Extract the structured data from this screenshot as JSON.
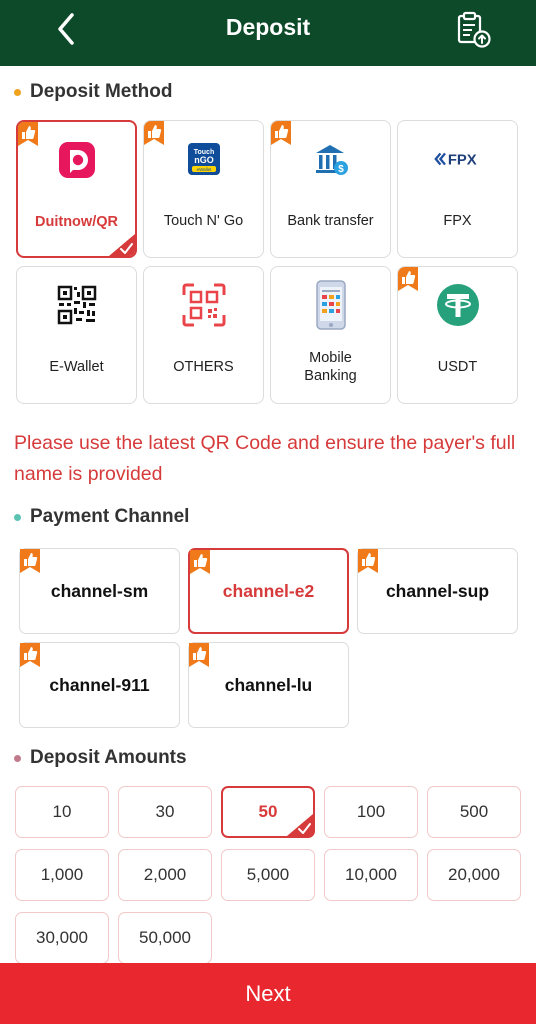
{
  "header": {
    "title": "Deposit"
  },
  "sections": {
    "method": "Deposit Method",
    "channel": "Payment Channel",
    "amounts": "Deposit Amounts"
  },
  "colors": {
    "header_bg": "#0d4a2a",
    "accent_red": "#d63a3a",
    "next_bg": "#e8282e",
    "dot_method": "#f0a21c",
    "dot_channel": "#5cc3b3",
    "dot_amounts": "#c07a8c"
  },
  "methods": [
    {
      "label": "Duitnow/QR",
      "icon": "duitnow-icon",
      "selected": true,
      "badge": true
    },
    {
      "label": "Touch N' Go",
      "icon": "touch-n-go-icon",
      "selected": false,
      "badge": true
    },
    {
      "label": "Bank transfer",
      "icon": "bank-icon",
      "selected": false,
      "badge": true
    },
    {
      "label": "FPX",
      "icon": "fpx-icon",
      "selected": false,
      "badge": false
    },
    {
      "label": "E-Wallet",
      "icon": "qr-code-icon",
      "selected": false,
      "badge": false
    },
    {
      "label": "OTHERS",
      "icon": "qr-scan-icon",
      "selected": false,
      "badge": false
    },
    {
      "label": "Mobile Banking",
      "icon": "mobile-banking-icon",
      "selected": false,
      "badge": false
    },
    {
      "label": "USDT",
      "icon": "tether-icon",
      "selected": false,
      "badge": true
    }
  ],
  "icon_text": {
    "tng_line1": "Touch",
    "tng_line2": "nGO",
    "tng_line3": "eWallet",
    "fpx": "FPX"
  },
  "notice": "Please use the latest QR Code and ensure the payer's full name is provided",
  "channels": [
    {
      "label": "channel-sm",
      "selected": false
    },
    {
      "label": "channel-e2",
      "selected": true
    },
    {
      "label": "channel-sup",
      "selected": false
    },
    {
      "label": "channel-911",
      "selected": false
    },
    {
      "label": "channel-lu",
      "selected": false
    }
  ],
  "amounts": [
    {
      "label": "10",
      "selected": false
    },
    {
      "label": "30",
      "selected": false
    },
    {
      "label": "50",
      "selected": true
    },
    {
      "label": "100",
      "selected": false
    },
    {
      "label": "500",
      "selected": false
    },
    {
      "label": "1,000",
      "selected": false
    },
    {
      "label": "2,000",
      "selected": false
    },
    {
      "label": "5,000",
      "selected": false
    },
    {
      "label": "10,000",
      "selected": false
    },
    {
      "label": "20,000",
      "selected": false
    },
    {
      "label": "30,000",
      "selected": false
    },
    {
      "label": "50,000",
      "selected": false
    }
  ],
  "next_label": "Next"
}
